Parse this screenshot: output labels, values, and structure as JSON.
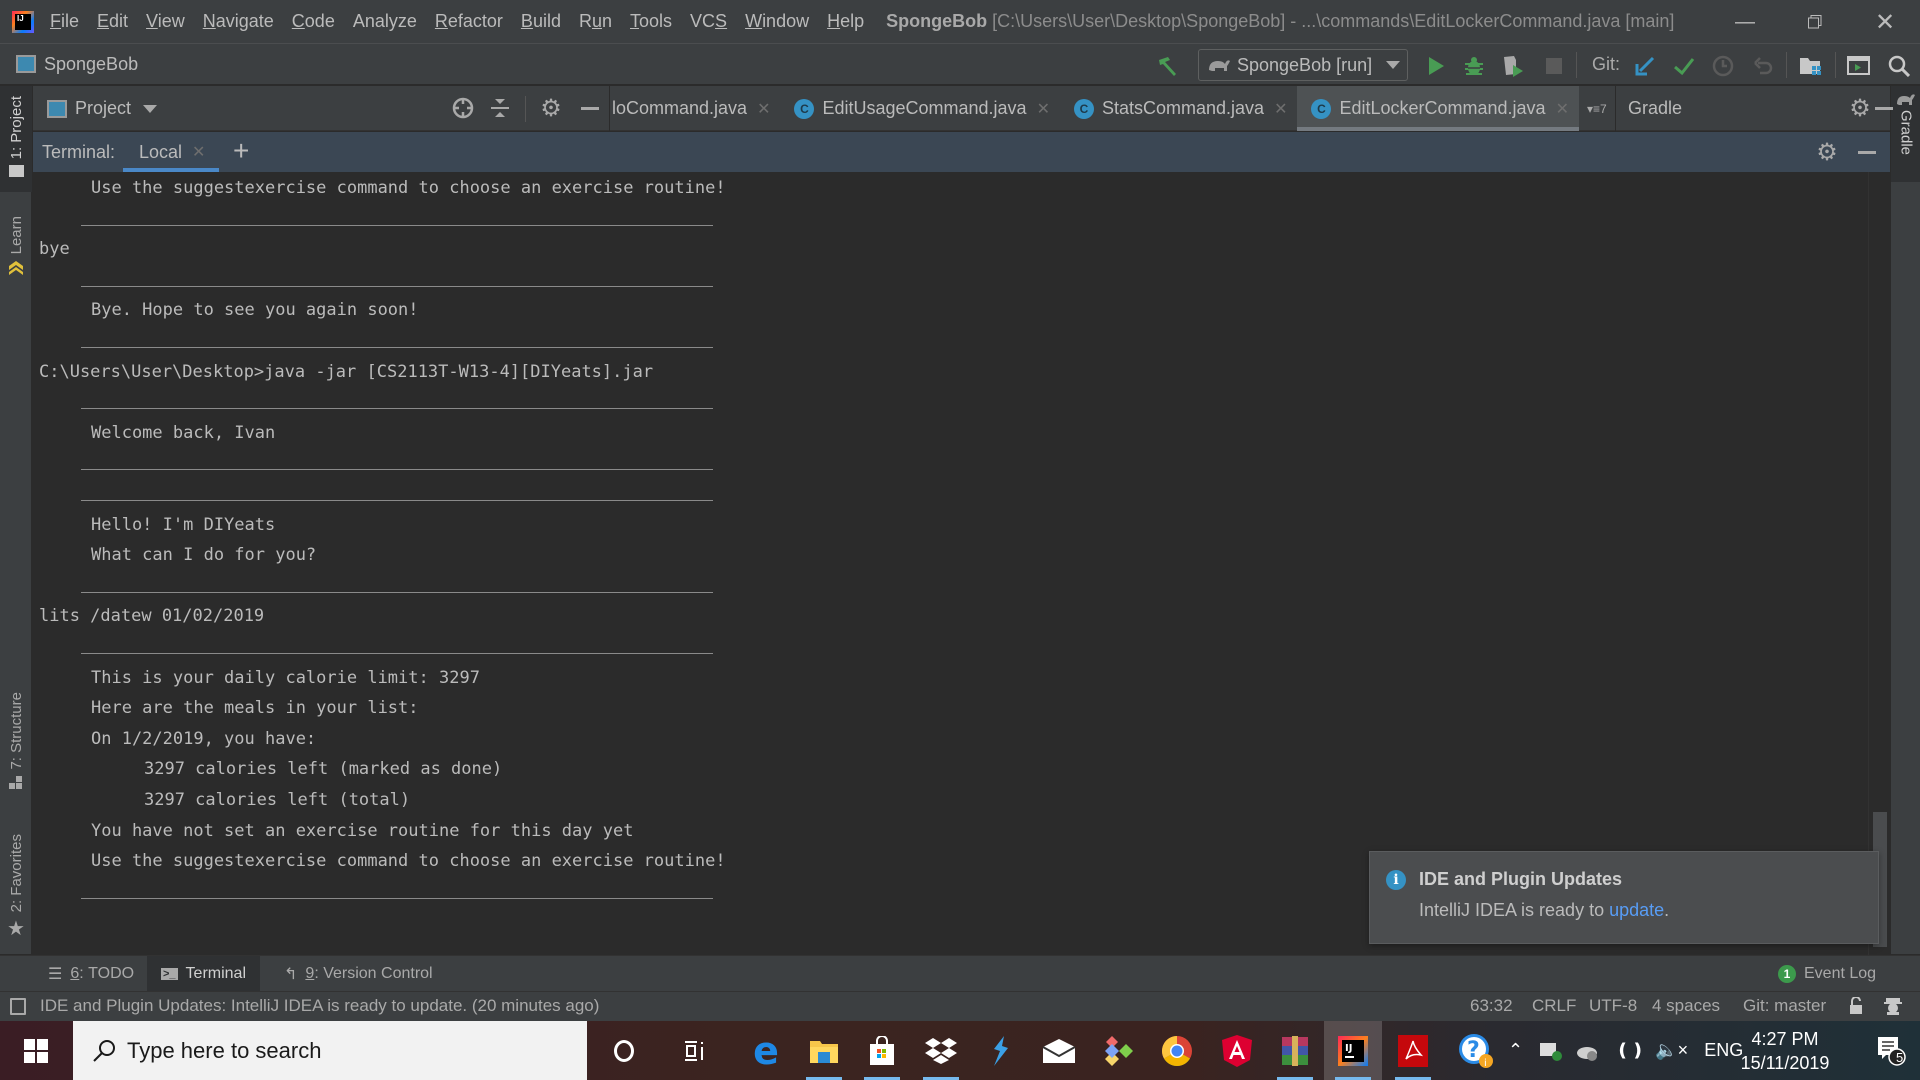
{
  "menubar": {
    "items": [
      "File",
      "Edit",
      "View",
      "Navigate",
      "Code",
      "Analyze",
      "Refactor",
      "Build",
      "Run",
      "Tools",
      "VCS",
      "Window",
      "Help"
    ],
    "mnemonics": [
      "F",
      "E",
      "V",
      "N",
      "C",
      "",
      "R",
      "B",
      "u",
      "T",
      "S",
      "W",
      "H"
    ],
    "project_name": "SpongeBob",
    "window_title_rest": "[C:\\Users\\User\\Desktop\\SpongeBob] - ...\\commands\\EditLockerCommand.java [main]"
  },
  "navbar": {
    "project_label": "SpongeBob",
    "run_config": "SpongeBob [run]",
    "git_label": "Git:"
  },
  "left_stripe": {
    "tabs": [
      "1: Project",
      "Learn",
      "7: Structure",
      "2: Favorites"
    ]
  },
  "right_stripe": {
    "tabs": [
      "Gradle"
    ]
  },
  "project_pane": {
    "title": "Project"
  },
  "editor_tabs": [
    {
      "label": "loCommand.java",
      "active": false
    },
    {
      "label": "EditUsageCommand.java",
      "active": false
    },
    {
      "label": "StatsCommand.java",
      "active": false
    },
    {
      "label": "EditLockerCommand.java",
      "active": true
    }
  ],
  "editor_tabs_overflow": "7",
  "gradle_pane": {
    "title": "Gradle"
  },
  "terminal": {
    "title": "Terminal:",
    "tabs": [
      {
        "label": "Local",
        "active": true
      }
    ],
    "add_label": "+",
    "lines": [
      {
        "text": "Use the suggestexercise command to choose an exercise routine!",
        "indent": 1
      },
      {
        "sep": true
      },
      {
        "text": "bye",
        "indent": 0
      },
      {
        "sep": true
      },
      {
        "text": "Bye. Hope to see you again soon!",
        "indent": 1
      },
      {
        "sep": true
      },
      {
        "text": "C:\\Users\\User\\Desktop>java -jar [CS2113T-W13-4][DIYeats].jar",
        "indent": 0
      },
      {
        "sep": true
      },
      {
        "text": "Welcome back, Ivan",
        "indent": 1
      },
      {
        "sep": true
      },
      {
        "sep": true
      },
      {
        "text": "Hello! I'm DIYeats",
        "indent": 1
      },
      {
        "text": "What can I do for you?",
        "indent": 1
      },
      {
        "sep": true
      },
      {
        "text": "lits /datew 01/02/2019",
        "indent": 0
      },
      {
        "sep": true
      },
      {
        "text": "This is your daily calorie limit: 3297",
        "indent": 1
      },
      {
        "text": "Here are the meals in your list:",
        "indent": 1
      },
      {
        "text": "On 1/2/2019, you have:",
        "indent": 1
      },
      {
        "text": "3297 calories left (marked as done)",
        "indent": 2
      },
      {
        "text": "3297 calories left (total)",
        "indent": 2
      },
      {
        "text": "You have not set an exercise routine for this day yet",
        "indent": 1
      },
      {
        "text": "Use the suggestexercise command to choose an exercise routine!",
        "indent": 1
      },
      {
        "sep": true
      }
    ]
  },
  "notification": {
    "title": "IDE and Plugin Updates",
    "body_prefix": "IntelliJ IDEA is ready to ",
    "link": "update",
    "body_suffix": "."
  },
  "tool_windows": {
    "tabs": [
      {
        "label": "TODO",
        "mnemonic": "6",
        "active": false
      },
      {
        "label": "Terminal",
        "mnemonic": "",
        "active": true
      },
      {
        "label": "Version Control",
        "mnemonic": "9",
        "active": false
      }
    ],
    "event_log": {
      "label": "Event Log",
      "count": "1"
    }
  },
  "status_bar": {
    "message": "IDE and Plugin Updates: IntelliJ IDEA is ready to update. (20 minutes ago)",
    "position": "63:32",
    "line_separator": "CRLF",
    "encoding": "UTF-8",
    "indent": "4 spaces",
    "vcs_branch": "Git: master"
  },
  "taskbar": {
    "search_placeholder": "Type here to search",
    "language": "ENG",
    "time": "4:27 PM",
    "date": "15/11/2019",
    "notification_count": "5"
  },
  "colors": {
    "accent_blue": "#4a88c7",
    "run_green": "#499c54",
    "link_blue": "#589df6",
    "class_icon_blue": "#3592c4"
  }
}
